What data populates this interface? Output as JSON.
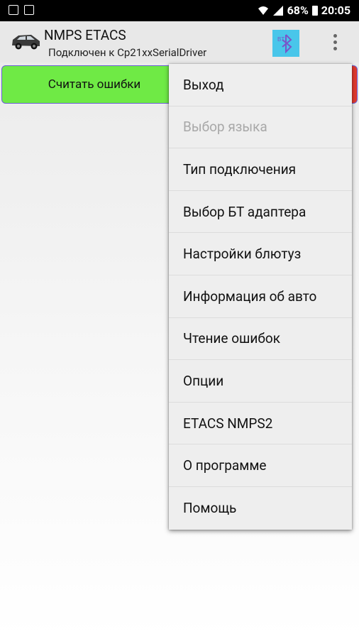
{
  "status_bar": {
    "battery": "68%",
    "time": "20:05",
    "icons": [
      "image-icon",
      "document-icon",
      "wifi-icon",
      "signal-icon",
      "battery-icon"
    ]
  },
  "app_bar": {
    "title": "NMPS ETACS",
    "subtitle": "Подключен к Cp21xxSerialDriver",
    "logo_text": "BT"
  },
  "main": {
    "read_errors_label": "Считать ошибки",
    "colors": {
      "green_button": "#6fea45",
      "red_button": "#e23a2e"
    }
  },
  "menu": {
    "items": [
      {
        "label": "Выход",
        "enabled": true
      },
      {
        "label": "Выбор языка",
        "enabled": false
      },
      {
        "label": "Тип подключения",
        "enabled": true
      },
      {
        "label": "Выбор БТ адаптера",
        "enabled": true
      },
      {
        "label": "Настройки блютуз",
        "enabled": true
      },
      {
        "label": "Информация об авто",
        "enabled": true
      },
      {
        "label": "Чтение ошибок",
        "enabled": true
      },
      {
        "label": "Опции",
        "enabled": true
      },
      {
        "label": "ETACS NMPS2",
        "enabled": true
      },
      {
        "label": "О программе",
        "enabled": true
      },
      {
        "label": "Помощь",
        "enabled": true
      }
    ]
  }
}
